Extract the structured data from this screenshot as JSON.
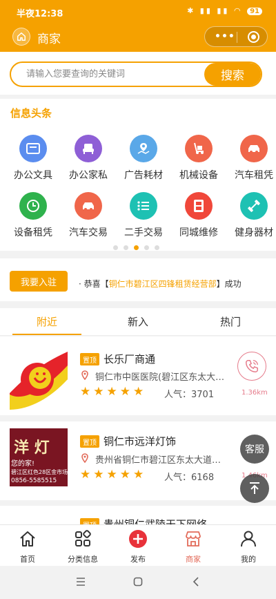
{
  "status_bar": {
    "time": "半夜12:38",
    "battery": "91"
  },
  "header": {
    "title": "商家"
  },
  "search": {
    "placeholder": "请输入您要查询的关键词",
    "button": "搜索"
  },
  "categories": {
    "title": "信息头条",
    "items": [
      {
        "label": "办公文具",
        "icon": "stationery-icon",
        "color": "#5b8def"
      },
      {
        "label": "办公家私",
        "icon": "armchair-icon",
        "color": "#8e5fd6"
      },
      {
        "label": "广告耗材",
        "icon": "map-icon",
        "color": "#5aa8e8"
      },
      {
        "label": "机械设备",
        "icon": "hand-truck-icon",
        "color": "#f0664a"
      },
      {
        "label": "汽车租凭",
        "icon": "car-icon",
        "color": "#f0664a"
      },
      {
        "label": "设备租凭",
        "icon": "clock-icon",
        "color": "#2fb24d"
      },
      {
        "label": "汽车交易",
        "icon": "car-icon",
        "color": "#f0664a"
      },
      {
        "label": "二手交易",
        "icon": "list-icon",
        "color": "#1ec1b3"
      },
      {
        "label": "同城维修",
        "icon": "cabinet-icon",
        "color": "#f0473a"
      },
      {
        "label": "健身器材",
        "icon": "dumbbell-icon",
        "color": "#1ec1b3"
      }
    ],
    "page_count": 5,
    "active_page": 3
  },
  "join": {
    "button": "我要入驻",
    "ticker_prefix": "· 恭喜【",
    "ticker_name": "铜仁市碧江区四锋租赁经营部",
    "ticker_suffix": "】成功"
  },
  "tabs": [
    {
      "label": "附近",
      "active": true
    },
    {
      "label": "新入",
      "active": false
    },
    {
      "label": "热门",
      "active": false
    }
  ],
  "shops": [
    {
      "tag": "置顶",
      "name": "长乐厂商通",
      "address": "铜仁市中医医院(碧江区东太大道)",
      "rating": 5,
      "popularity": "人气：3701",
      "distance": "1.36km"
    },
    {
      "tag": "置顶",
      "name": "铜仁市远洋灯饰",
      "address": "贵州省铜仁市碧江区东太大道银湖",
      "rating": 5,
      "popularity": "人气：6168",
      "distance": "1.46km",
      "image_text": "洋 灯",
      "image_small": "您的家!",
      "image_line2": "碧江区红色28区金市场",
      "image_phone": "0856-5585515"
    },
    {
      "tag": "置顶",
      "name": "贵州铜仁武陵天下网络"
    }
  ],
  "floats": {
    "kefu": "客服"
  },
  "tabbar": [
    {
      "label": "首页",
      "icon": "home-icon"
    },
    {
      "label": "分类信息",
      "icon": "grid-icon"
    },
    {
      "label": "发布",
      "icon": "plus-icon"
    },
    {
      "label": "商家",
      "icon": "shop-icon",
      "active": true
    },
    {
      "label": "我的",
      "icon": "user-icon"
    }
  ],
  "colors": {
    "brand": "#f5a100",
    "accent_red": "#e26b5a",
    "phone": "#e57a8a"
  }
}
